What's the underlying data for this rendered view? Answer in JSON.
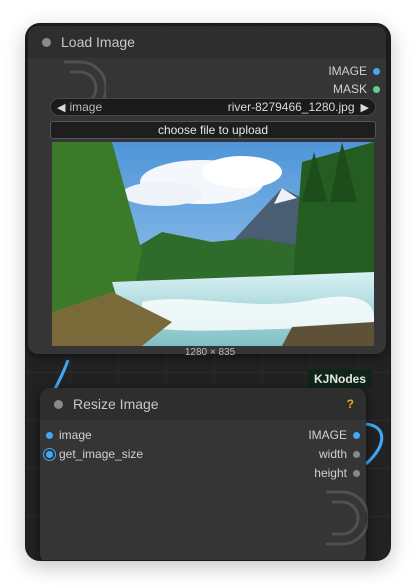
{
  "load_image": {
    "title": "Load Image",
    "outputs": [
      {
        "label": "IMAGE",
        "color": "#3fa9f5"
      },
      {
        "label": "MASK",
        "color": "#5fd18a"
      }
    ],
    "combo": {
      "name": "image",
      "value": "river-8279466_1280.jpg"
    },
    "upload_button": "choose file to upload",
    "dimensions": "1280 × 835"
  },
  "badge": "KJNodes",
  "resize_image": {
    "title": "Resize Image",
    "help": "?",
    "inputs": [
      {
        "label": "image",
        "color": "#3fa9f5"
      },
      {
        "label": "get_image_size",
        "color": "#3fa9f5"
      }
    ],
    "outputs": [
      {
        "label": "IMAGE",
        "color": "#3fa9f5"
      },
      {
        "label": "width",
        "color": "#888888"
      },
      {
        "label": "height",
        "color": "#888888"
      }
    ]
  },
  "icons": {
    "combo_left": "◀",
    "combo_right": "▶"
  },
  "colors": {
    "image_link": "#3fa9f5",
    "help": "#f5a623",
    "badge_bg": "#0f2517"
  }
}
